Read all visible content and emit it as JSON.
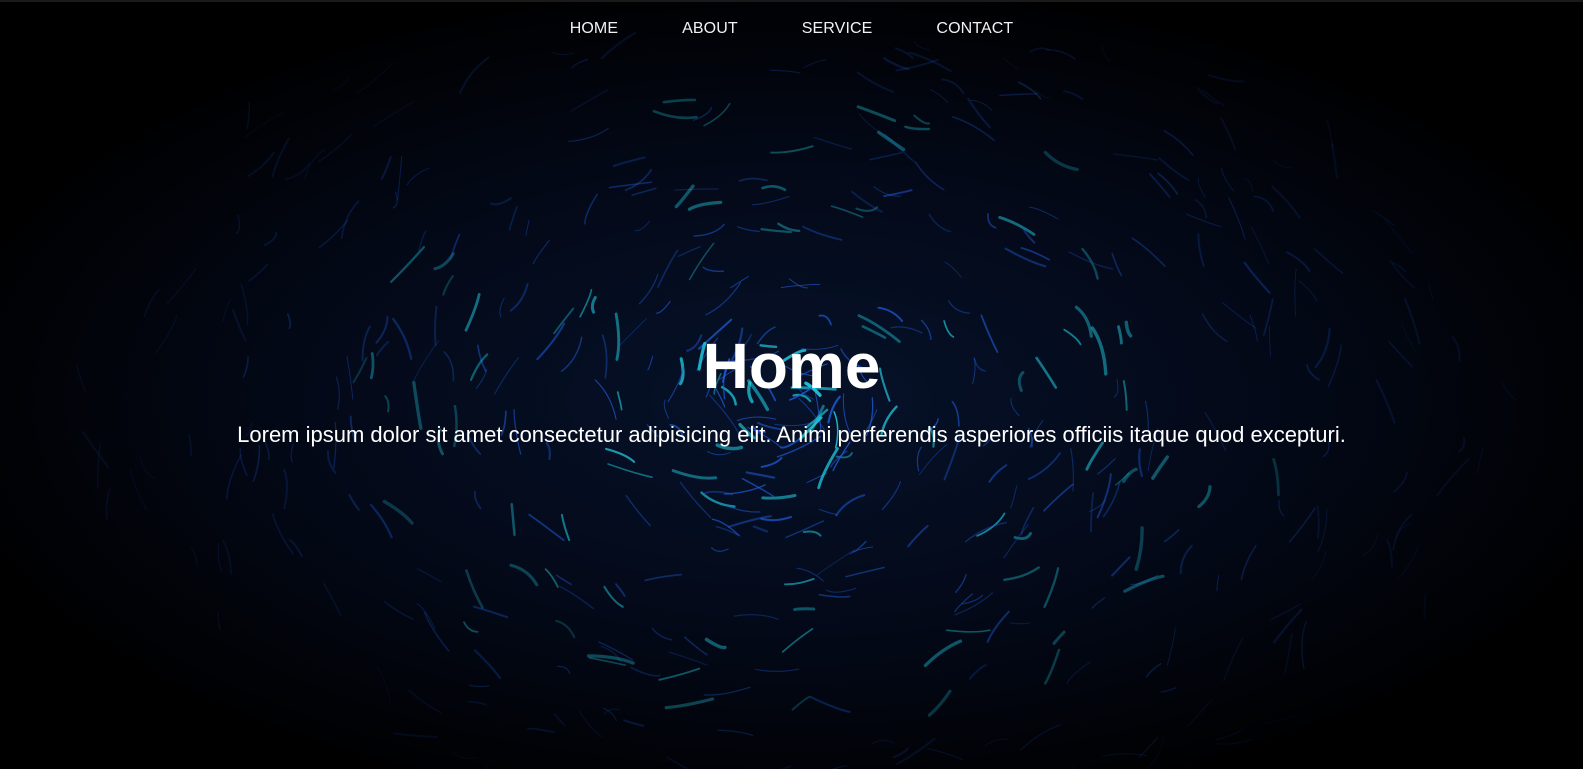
{
  "nav": {
    "items": [
      {
        "label": "HOME"
      },
      {
        "label": "ABOUT"
      },
      {
        "label": "SERVICE"
      },
      {
        "label": "CONTACT"
      }
    ]
  },
  "hero": {
    "title": "Home",
    "subtitle": "Lorem ipsum dolor sit amet consectetur adipisicing elit. Animi perferendis asperiores officiis itaque quod excepturi.",
    "background_image": "dark-space-light-streaks-image"
  },
  "colors": {
    "background": "#000000",
    "text": "#ffffff",
    "streak_cyan": "#22d3e6",
    "streak_blue": "#1e5bd8"
  }
}
